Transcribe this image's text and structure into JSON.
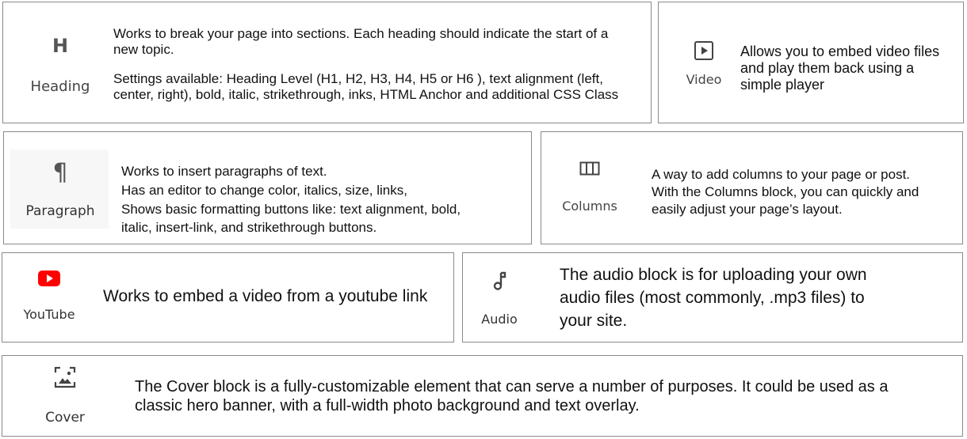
{
  "blocks": {
    "heading": {
      "icon": "heading-icon",
      "label": "Heading",
      "desc_line1": "Works to break your page into sections. Each heading should indicate the start of a",
      "desc_line2": "new topic.",
      "desc_line3": "Settings available: Heading Level (H1, H2, H3, H4, H5 or H6 ), text alignment (left,",
      "desc_line4": "center, right), bold, italic, strikethrough, inks, HTML Anchor and additional CSS Class"
    },
    "video": {
      "icon": "video-icon",
      "label": "Video",
      "desc_line1": "Allows you to embed video files",
      "desc_line2": "and play them back using a",
      "desc_line3": "simple player"
    },
    "paragraph": {
      "icon": "pilcrow-icon",
      "label": "Paragraph",
      "desc_line1": "Works to insert paragraphs of text.",
      "desc_line2": "Has an editor to change color, italics, size, links,",
      "desc_line3": "Shows basic formatting buttons like: text alignment, bold,",
      "desc_line4": "italic, insert-link, and strikethrough buttons."
    },
    "columns": {
      "icon": "columns-icon",
      "label": "Columns",
      "desc_line1": "A way to add columns to your page or post.",
      "desc_line2": "With the Columns block, you can quickly and",
      "desc_line3": "easily adjust your page’s layout."
    },
    "youtube": {
      "icon": "youtube-icon",
      "label": "YouTube",
      "desc_line1": "Works to embed a video from a youtube link"
    },
    "audio": {
      "icon": "music-note-icon",
      "label": "Audio",
      "desc_line1": "The audio block is for uploading your own",
      "desc_line2": "audio files (most commonly, .mp3 files) to",
      "desc_line3": "your site."
    },
    "cover": {
      "icon": "cover-image-icon",
      "label": "Cover",
      "desc_line1": "The Cover block is a fully-customizable element that can serve a number of purposes. It could be used as a",
      "desc_line2": "classic hero banner, with a full-width photo background and text overlay."
    }
  },
  "colors": {
    "youtube_red": "#ff0000",
    "icon_gray": "#555555",
    "border": "#8a8a8a"
  }
}
